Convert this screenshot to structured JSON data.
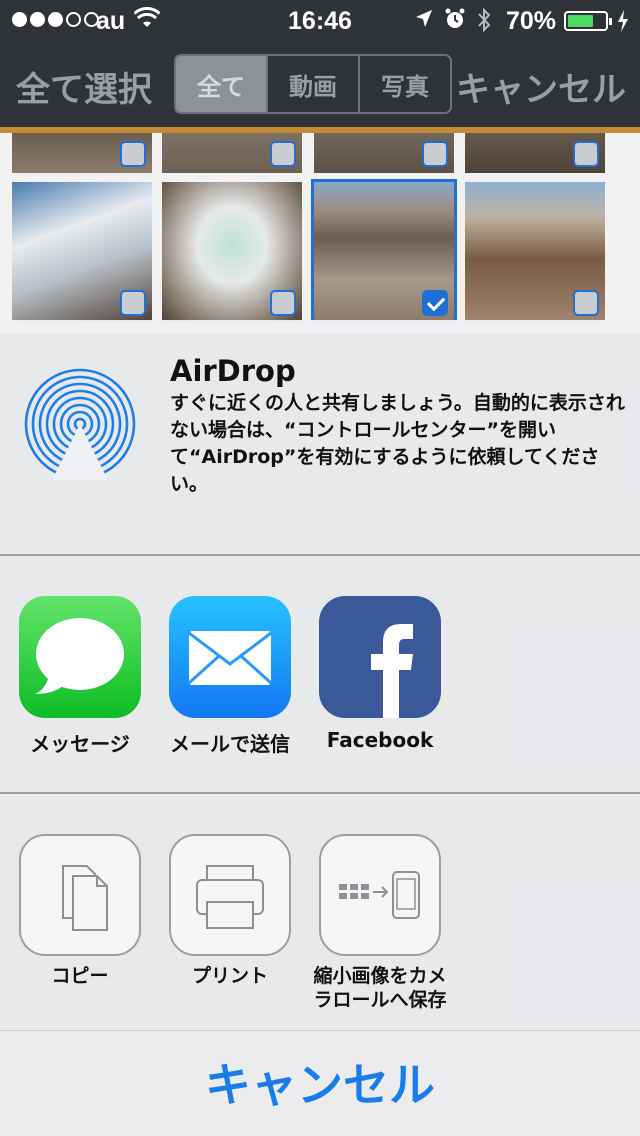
{
  "status_bar": {
    "carrier": "au",
    "time": "16:46",
    "battery_percent": "70%",
    "battery_level": 0.7,
    "signal_bars": 3,
    "icons": [
      "wifi-icon",
      "location-icon",
      "alarm-icon",
      "bluetooth-icon",
      "battery-icon",
      "charging-icon"
    ]
  },
  "toolbar": {
    "select_all": "全て選択",
    "segments": [
      "全て",
      "動画",
      "写真"
    ],
    "active_segment": "全て",
    "cancel": "キャンセル"
  },
  "photos": [
    {
      "checked": false
    },
    {
      "checked": false
    },
    {
      "checked": false
    },
    {
      "checked": false
    },
    {
      "checked": false
    },
    {
      "checked": false
    },
    {
      "checked": true
    },
    {
      "checked": false
    }
  ],
  "share_sheet": {
    "airdrop": {
      "title": "AirDrop",
      "description": "すぐに近くの人と共有しましょう。自動的に表示されない場合は、“コントロールセンター”を開いて“AirDrop”を有効にするように依頼してください。"
    },
    "apps": [
      {
        "label": "メッセージ",
        "icon": "messages-icon"
      },
      {
        "label": "メールで送信",
        "icon": "mail-icon"
      },
      {
        "label": "Facebook",
        "icon": "facebook-icon"
      }
    ],
    "actions": [
      {
        "label": "コピー",
        "icon": "copy-icon"
      },
      {
        "label": "プリント",
        "icon": "print-icon"
      },
      {
        "label": "縮小画像をカメラロールへ保存",
        "icon": "save-to-camera-roll-icon"
      }
    ],
    "cancel": "キャンセル"
  },
  "colors": {
    "accent": "#1a7bea",
    "toolbar_bg": "#2f3338",
    "toolbar_stripe": "#c58a36",
    "battery_fill": "#4cd964"
  }
}
